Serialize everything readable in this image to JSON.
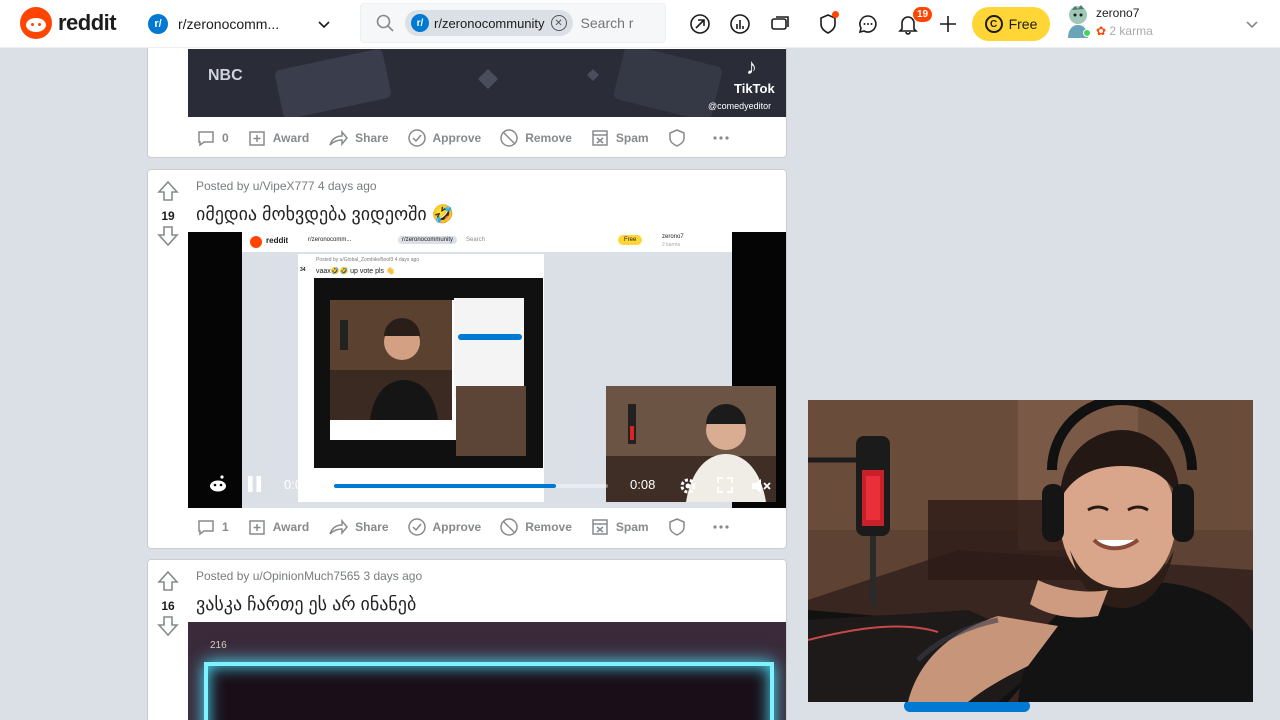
{
  "header": {
    "logo_text": "reddit",
    "community_badge": "r/",
    "community_name": "r/zeronocomm...",
    "search_chip": "r/zeronocommunity",
    "search_placeholder": "Search r",
    "notification_count": "19",
    "free_label": "Free",
    "coin_symbol": "C",
    "username": "zerono7",
    "karma": "2 karma",
    "karma_flower": "✿"
  },
  "posts": [
    {
      "comments": "0",
      "media": {
        "nbc": "NBC",
        "tiktok": "TikTok",
        "handle": "@comedyeditor"
      }
    },
    {
      "meta": "Posted by u/VipeX777 4 days ago",
      "score": "19",
      "title": "იმედია მოხვდება ვიდეოში 🤣",
      "comments": "1",
      "video": {
        "current_time": "0:06",
        "duration": "0:08",
        "progress": 0.81
      },
      "inner": {
        "logo": "reddit",
        "community": "r/zeronocomm...",
        "chip": "r/zeronocommunity",
        "search": "Search",
        "free": "Free",
        "user": "zerono7",
        "karma": "2 karma",
        "meta": "Posted by u/Global_ZombikeBoof3 4 days ago",
        "score": "34",
        "title": "vaax🤣🤣 up vote pls 👋"
      }
    },
    {
      "meta": "Posted by u/OpinionMuch7565 3 days ago",
      "score": "16",
      "title": "ვასკა ჩართე ეს არ ინანებ",
      "media_label": "216"
    }
  ],
  "actions": {
    "award": "Award",
    "share": "Share",
    "approve": "Approve",
    "remove": "Remove",
    "spam": "Spam"
  },
  "colors": {
    "brand": "#ff4500",
    "accent": "#0079d3",
    "premium": "#ffd635",
    "background": "#dae0e6"
  }
}
